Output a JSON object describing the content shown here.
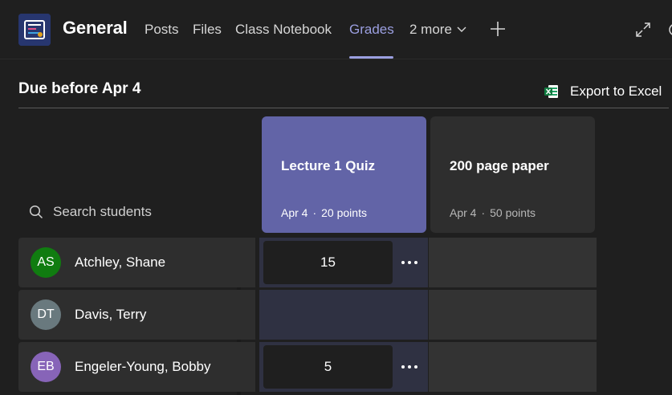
{
  "header": {
    "channel_title": "General",
    "tabs": [
      {
        "label": "Posts",
        "active": false
      },
      {
        "label": "Files",
        "active": false
      },
      {
        "label": "Class Notebook",
        "active": false
      },
      {
        "label": "Grades",
        "active": true
      },
      {
        "label": "2 more",
        "active": false
      }
    ],
    "icons": [
      "app-logo",
      "chevron-down-icon",
      "plus-icon",
      "expand-icon",
      "refresh-icon"
    ]
  },
  "toolbar": {
    "due_title": "Due before Apr 4",
    "export_label": "Export to Excel"
  },
  "search": {
    "placeholder": "Search students"
  },
  "assignments": [
    {
      "title": "Lecture 1 Quiz",
      "date": "Apr 4",
      "points": "20 points",
      "selected": true
    },
    {
      "title": "200 page paper",
      "date": "Apr 4",
      "points": "50 points",
      "selected": false
    }
  ],
  "students": [
    {
      "initials": "AS",
      "name": "Atchley, Shane",
      "avatar_color": "#107c10",
      "grade": "15"
    },
    {
      "initials": "DT",
      "name": "Davis, Terry",
      "avatar_color": "#69797e",
      "grade": ""
    },
    {
      "initials": "EB",
      "name": "Engeler-Young, Bobby",
      "avatar_color": "#8764b8",
      "grade": "5"
    }
  ],
  "colors": {
    "accent": "#6264a7",
    "active_tab": "#9b9fe0"
  }
}
